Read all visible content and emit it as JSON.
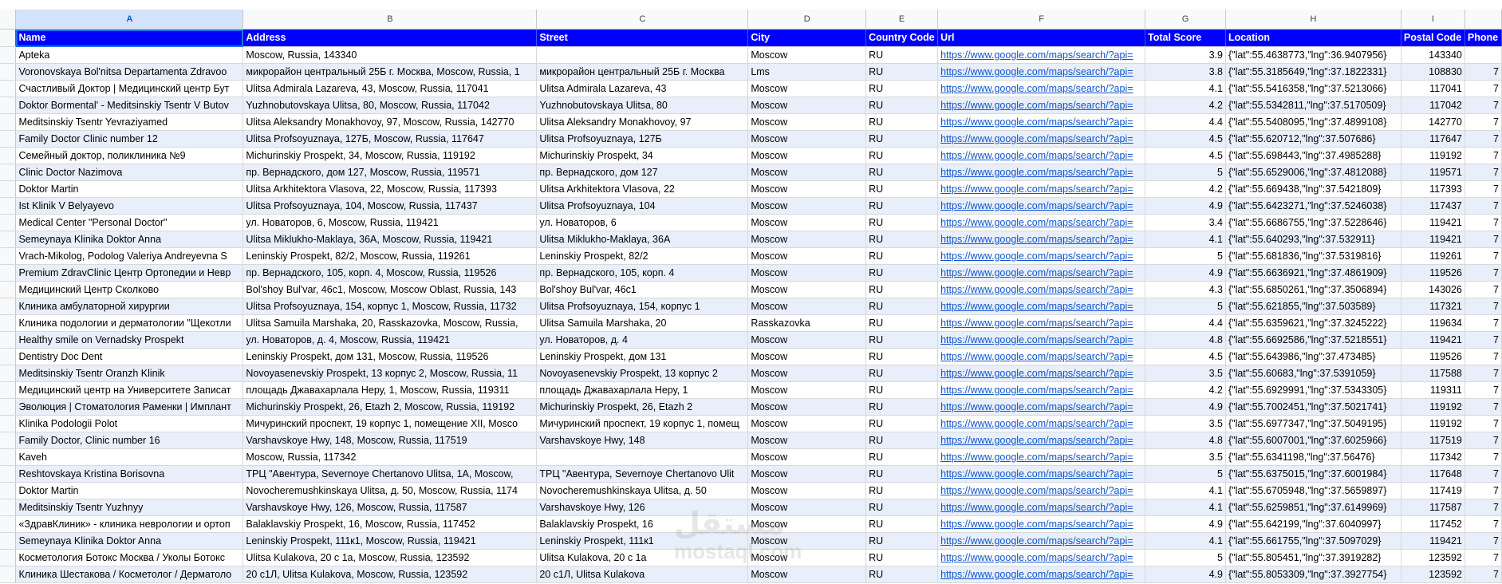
{
  "columns": [
    "A",
    "B",
    "C",
    "D",
    "E",
    "F",
    "G",
    "H",
    "I"
  ],
  "header": [
    "Name",
    "Address",
    "Street",
    "City",
    "Country Code",
    "Url",
    "Total Score",
    "Location",
    "Postal Code",
    "Phone"
  ],
  "rows": [
    [
      "Apteka",
      "Moscow, Russia, 143340",
      "",
      "Moscow",
      "RU",
      "https://www.google.com/maps/search/?api=",
      "3.9",
      "{\"lat\":55.4638773,\"lng\":36.9407956}",
      "143340",
      ""
    ],
    [
      "Voronovskaya Bol'nitsa Departamenta Zdravoo",
      "микрорайон центральный 25Б г. Москва, Moscow, Russia, 1",
      "микрорайон центральный 25Б г. Москва",
      "Lms",
      "RU",
      "https://www.google.com/maps/search/?api=",
      "3.8",
      "{\"lat\":55.3185649,\"lng\":37.1822331}",
      "108830",
      "7"
    ],
    [
      "Счастливый Доктор | Медицинский центр Бут",
      "Ulitsa Admirala Lazareva, 43, Moscow, Russia, 117041",
      "Ulitsa Admirala Lazareva, 43",
      "Moscow",
      "RU",
      "https://www.google.com/maps/search/?api=",
      "4.1",
      "{\"lat\":55.5416358,\"lng\":37.5213066}",
      "117041",
      "7"
    ],
    [
      "Doktor Bormental' - Meditsinskiy Tsentr V Butov",
      "Yuzhnobutovskaya Ulitsa, 80, Moscow, Russia, 117042",
      "Yuzhnobutovskaya Ulitsa, 80",
      "Moscow",
      "RU",
      "https://www.google.com/maps/search/?api=",
      "4.2",
      "{\"lat\":55.5342811,\"lng\":37.5170509}",
      "117042",
      "7"
    ],
    [
      "Meditsinskiy Tsentr Yevraziyamed",
      "Ulitsa Aleksandry Monakhovoy, 97, Moscow, Russia, 142770",
      "Ulitsa Aleksandry Monakhovoy, 97",
      "Moscow",
      "RU",
      "https://www.google.com/maps/search/?api=",
      "4.4",
      "{\"lat\":55.5408095,\"lng\":37.4899108}",
      "142770",
      "7"
    ],
    [
      "Family Doctor Clinic number 12",
      "Ulitsa Profsoyuznaya, 127Б, Moscow, Russia, 117647",
      "Ulitsa Profsoyuznaya, 127Б",
      "Moscow",
      "RU",
      "https://www.google.com/maps/search/?api=",
      "4.5",
      "{\"lat\":55.620712,\"lng\":37.507686}",
      "117647",
      "7"
    ],
    [
      "Семейный доктор, поликлиника №9",
      "Michurinskiy Prospekt, 34, Moscow, Russia, 119192",
      "Michurinskiy Prospekt, 34",
      "Moscow",
      "RU",
      "https://www.google.com/maps/search/?api=",
      "4.5",
      "{\"lat\":55.698443,\"lng\":37.4985288}",
      "119192",
      "7"
    ],
    [
      "Clinic Doctor Nazimova",
      "пр. Вернадского, дом 127, Moscow, Russia, 119571",
      "пр. Вернадского, дом 127",
      "Moscow",
      "RU",
      "https://www.google.com/maps/search/?api=",
      "5",
      "{\"lat\":55.6529006,\"lng\":37.4812088}",
      "119571",
      "7"
    ],
    [
      "Doktor Martin",
      "Ulitsa Arkhitektora Vlasova, 22, Moscow, Russia, 117393",
      "Ulitsa Arkhitektora Vlasova, 22",
      "Moscow",
      "RU",
      "https://www.google.com/maps/search/?api=",
      "4.2",
      "{\"lat\":55.669438,\"lng\":37.5421809}",
      "117393",
      "7"
    ],
    [
      "Ist Klinik V Belyayevo",
      "Ulitsa Profsoyuznaya, 104, Moscow, Russia, 117437",
      "Ulitsa Profsoyuznaya, 104",
      "Moscow",
      "RU",
      "https://www.google.com/maps/search/?api=",
      "4.9",
      "{\"lat\":55.6423271,\"lng\":37.5246038}",
      "117437",
      "7"
    ],
    [
      "Medical Center \"Personal Doctor\"",
      "ул. Новаторов, 6, Moscow, Russia, 119421",
      "ул. Новаторов, 6",
      "Moscow",
      "RU",
      "https://www.google.com/maps/search/?api=",
      "3.4",
      "{\"lat\":55.6686755,\"lng\":37.5228646}",
      "119421",
      "7"
    ],
    [
      "Semeynaya Klinika Doktor Anna",
      "Ulitsa Miklukho-Maklaya, 36A, Moscow, Russia, 119421",
      "Ulitsa Miklukho-Maklaya, 36A",
      "Moscow",
      "RU",
      "https://www.google.com/maps/search/?api=",
      "4.1",
      "{\"lat\":55.640293,\"lng\":37.532911}",
      "119421",
      "7"
    ],
    [
      "Vrach-Mikolog, Podolog Valeriya Andreyevna S",
      "Leninskiy Prospekt, 82/2, Moscow, Russia, 119261",
      "Leninskiy Prospekt, 82/2",
      "Moscow",
      "RU",
      "https://www.google.com/maps/search/?api=",
      "5",
      "{\"lat\":55.681836,\"lng\":37.5319816}",
      "119261",
      "7"
    ],
    [
      "Premium ZdravClinic Центр Ортопедии и Невр",
      "пр. Вернадского, 105, корп. 4, Moscow, Russia, 119526",
      "пр. Вернадского, 105, корп. 4",
      "Moscow",
      "RU",
      "https://www.google.com/maps/search/?api=",
      "4.9",
      "{\"lat\":55.6636921,\"lng\":37.4861909}",
      "119526",
      "7"
    ],
    [
      "Медицинский Центр Сколково",
      "Bol'shoy Bul'var, 46с1, Moscow, Moscow Oblast, Russia, 143",
      "Bol'shoy Bul'var, 46с1",
      "Moscow",
      "RU",
      "https://www.google.com/maps/search/?api=",
      "4.3",
      "{\"lat\":55.6850261,\"lng\":37.3506894}",
      "143026",
      "7"
    ],
    [
      "Клиника амбулаторной хирургии",
      "Ulitsa Profsoyuznaya, 154, корпус 1, Moscow, Russia, 11732",
      "Ulitsa Profsoyuznaya, 154, корпус 1",
      "Moscow",
      "RU",
      "https://www.google.com/maps/search/?api=",
      "5",
      "{\"lat\":55.621855,\"lng\":37.503589}",
      "117321",
      "7"
    ],
    [
      "Клиника подологии и дерматологии \"Щекотли",
      "Ulitsa Samuila Marshaka, 20, Rasskazovka, Moscow, Russia,",
      "Ulitsa Samuila Marshaka, 20",
      "Rasskazovka",
      "RU",
      "https://www.google.com/maps/search/?api=",
      "4.4",
      "{\"lat\":55.6359621,\"lng\":37.3245222}",
      "119634",
      "7"
    ],
    [
      "Healthy smile on Vernadsky Prospekt",
      "ул. Новаторов, д. 4, Moscow, Russia, 119421",
      "ул. Новаторов, д. 4",
      "Moscow",
      "RU",
      "https://www.google.com/maps/search/?api=",
      "4.8",
      "{\"lat\":55.6692586,\"lng\":37.5218551}",
      "119421",
      "7"
    ],
    [
      "Dentistry Doc Dent",
      "Leninskiy Prospekt, дом 131, Moscow, Russia, 119526",
      "Leninskiy Prospekt, дом 131",
      "Moscow",
      "RU",
      "https://www.google.com/maps/search/?api=",
      "4.5",
      "{\"lat\":55.643986,\"lng\":37.473485}",
      "119526",
      "7"
    ],
    [
      "Meditsinskiy Tsentr Oranzh Klinik",
      "Novoyasenevskiy Prospekt, 13 корпус 2, Moscow, Russia, 11",
      "Novoyasenevskiy Prospekt, 13 корпус 2",
      "Moscow",
      "RU",
      "https://www.google.com/maps/search/?api=",
      "3.5",
      "{\"lat\":55.60683,\"lng\":37.5391059}",
      "117588",
      "7"
    ],
    [
      "Медицинский центр на Университете Записат",
      "площадь Джавахарлала Неру, 1, Moscow, Russia, 119311",
      "площадь Джавахарлала Неру, 1",
      "Moscow",
      "RU",
      "https://www.google.com/maps/search/?api=",
      "4.2",
      "{\"lat\":55.6929991,\"lng\":37.5343305}",
      "119311",
      "7"
    ],
    [
      "Эволюция | Стоматология Раменки | Имплант",
      "Michurinskiy Prospekt, 26, Etazh 2, Moscow, Russia, 119192",
      "Michurinskiy Prospekt, 26, Etazh 2",
      "Moscow",
      "RU",
      "https://www.google.com/maps/search/?api=",
      "4.9",
      "{\"lat\":55.7002451,\"lng\":37.5021741}",
      "119192",
      "7"
    ],
    [
      "Klinika Podologii Polot",
      "Мичуринский проспект, 19 корпус 1, помещение XII, Mosco",
      "Мичуринский проспект, 19 корпус 1, помещ",
      "Moscow",
      "RU",
      "https://www.google.com/maps/search/?api=",
      "3.5",
      "{\"lat\":55.6977347,\"lng\":37.5049195}",
      "119192",
      "7"
    ],
    [
      "Family Doctor, Clinic number 16",
      "Varshavskoye Hwy, 148, Moscow, Russia, 117519",
      "Varshavskoye Hwy, 148",
      "Moscow",
      "RU",
      "https://www.google.com/maps/search/?api=",
      "4.8",
      "{\"lat\":55.6007001,\"lng\":37.6025966}",
      "117519",
      "7"
    ],
    [
      "Kaveh",
      "Moscow, Russia, 117342",
      "",
      "Moscow",
      "RU",
      "https://www.google.com/maps/search/?api=",
      "3.5",
      "{\"lat\":55.6341198,\"lng\":37.56476}",
      "117342",
      "7"
    ],
    [
      "Reshtovskaya Kristina Borisovna",
      "ТРЦ \"Авентура, Severnoye Chertanovo Ulitsa, 1A, Moscow,",
      "ТРЦ \"Авентура, Severnoye Chertanovo Ulit",
      "Moscow",
      "RU",
      "https://www.google.com/maps/search/?api=",
      "5",
      "{\"lat\":55.6375015,\"lng\":37.6001984}",
      "117648",
      "7"
    ],
    [
      "Doktor Martin",
      "Novocheremushkinskaya Ulitsa, д. 50, Moscow, Russia, 1174",
      "Novocheremushkinskaya Ulitsa, д. 50",
      "Moscow",
      "RU",
      "https://www.google.com/maps/search/?api=",
      "4.1",
      "{\"lat\":55.6705948,\"lng\":37.5659897}",
      "117419",
      "7"
    ],
    [
      "Meditsinskiy Tsentr Yuzhnyy",
      "Varshavskoye Hwy, 126, Moscow, Russia, 117587",
      "Varshavskoye Hwy, 126",
      "Moscow",
      "RU",
      "https://www.google.com/maps/search/?api=",
      "4.1",
      "{\"lat\":55.6259851,\"lng\":37.6149969}",
      "117587",
      "7"
    ],
    [
      "«ЗдравКлиник» - клиника неврологии и ортоп",
      "Balaklavskiy Prospekt, 16, Moscow, Russia, 117452",
      "Balaklavskiy Prospekt, 16",
      "Moscow",
      "RU",
      "https://www.google.com/maps/search/?api=",
      "4.9",
      "{\"lat\":55.642199,\"lng\":37.6040997}",
      "117452",
      "7"
    ],
    [
      "Semeynaya Klinika Doktor Anna",
      "Leninskiy Prospekt, 111к1, Moscow, Russia, 119421",
      "Leninskiy Prospekt, 111к1",
      "Moscow",
      "RU",
      "https://www.google.com/maps/search/?api=",
      "4.1",
      "{\"lat\":55.661755,\"lng\":37.5097029}",
      "119421",
      "7"
    ],
    [
      "Косметология Ботокс Москва / Уколы Ботокс",
      "Ulitsa Kulakova, 20 с 1а, Moscow, Russia, 123592",
      "Ulitsa Kulakova, 20 с 1а",
      "Moscow",
      "RU",
      "https://www.google.com/maps/search/?api=",
      "5",
      "{\"lat\":55.805451,\"lng\":37.3919282}",
      "123592",
      "7"
    ],
    [
      "Клиника Шестакова / Косметолог / Дерматоло",
      "20 с1Л, Ulitsa Kulakova, Moscow, Russia, 123592",
      "20 с1Л, Ulitsa Kulakova",
      "Moscow",
      "RU",
      "https://www.google.com/maps/search/?api=",
      "4.9",
      "{\"lat\":55.8053309,\"lng\":37.3927754}",
      "123592",
      "7"
    ]
  ],
  "watermark": {
    "line1": "مستقل",
    "line2": "mostaql.com"
  }
}
